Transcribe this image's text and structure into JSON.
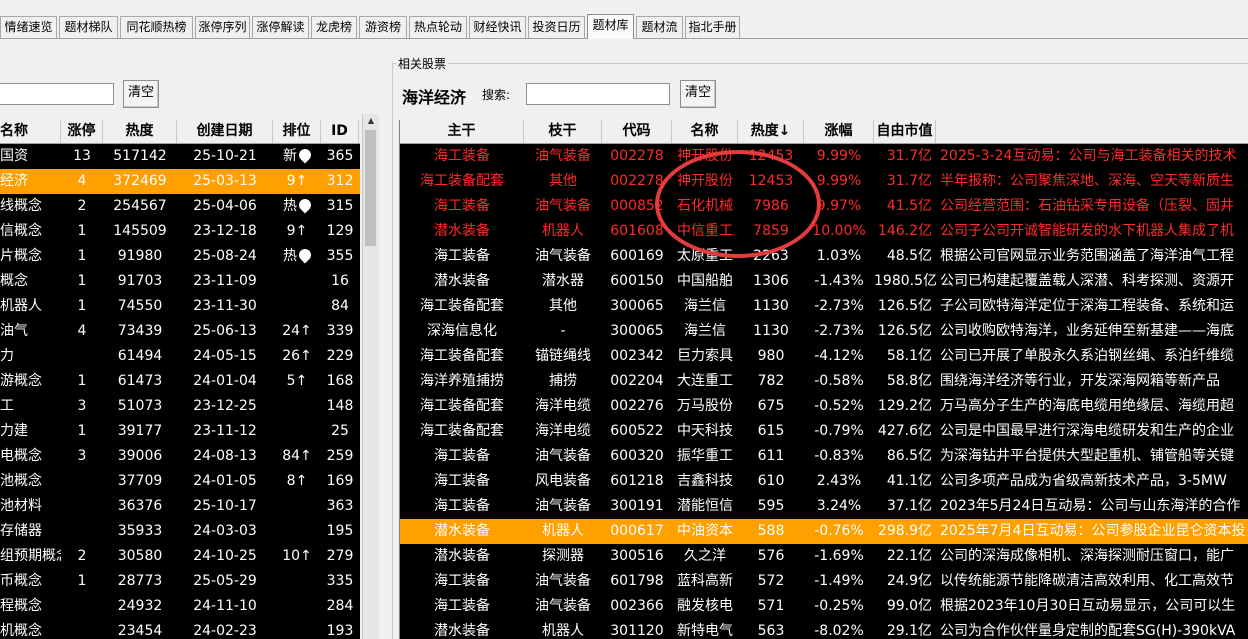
{
  "tabs": [
    "情绪速览",
    "题材梯队",
    "同花顺热榜",
    "涨停序列",
    "涨停解读",
    "龙虎榜",
    "游资榜",
    "热点轮动",
    "财经快讯",
    "投资日历",
    "题材库",
    "题材流",
    "指北手册"
  ],
  "active_tab": 10,
  "left": {
    "search_value": "",
    "clear_label": "清空",
    "headers": [
      "名称",
      "涨停",
      "热度",
      "创建日期",
      "排位",
      "ID"
    ],
    "rows": [
      [
        "国资",
        "13",
        "517142",
        "25-10-21",
        "新",
        "365"
      ],
      [
        "经济",
        "4",
        "372469",
        "25-03-13",
        "9↑",
        "312"
      ],
      [
        "线概念",
        "2",
        "254567",
        "25-04-06",
        "热",
        "315"
      ],
      [
        "信概念",
        "1",
        "145509",
        "23-12-18",
        "9↑",
        "129"
      ],
      [
        "片概念",
        "1",
        "91980",
        "25-08-24",
        "热",
        "355"
      ],
      [
        "概念",
        "1",
        "91703",
        "23-11-09",
        "",
        "16"
      ],
      [
        "机器人",
        "1",
        "74550",
        "23-11-30",
        "",
        "84"
      ],
      [
        "油气",
        "4",
        "73439",
        "25-06-13",
        "24↑",
        "339"
      ],
      [
        "力",
        "",
        "61494",
        "24-05-15",
        "26↑",
        "229"
      ],
      [
        "游概念",
        "1",
        "61473",
        "24-01-04",
        "5↑",
        "168"
      ],
      [
        "工",
        "3",
        "51073",
        "23-12-25",
        "",
        "148"
      ],
      [
        "力建",
        "1",
        "39177",
        "23-11-12",
        "",
        "25"
      ],
      [
        "电概念",
        "3",
        "39006",
        "24-08-13",
        "84↑",
        "259"
      ],
      [
        "池概念",
        "",
        "37709",
        "24-01-05",
        "8↑",
        "169"
      ],
      [
        "池材料",
        "",
        "36376",
        "25-10-17",
        "",
        "363"
      ],
      [
        "存储器",
        "",
        "35933",
        "24-03-03",
        "",
        "195"
      ],
      [
        "组预期概念",
        "2",
        "30580",
        "24-10-25",
        "10↑",
        "279"
      ],
      [
        "币概念",
        "1",
        "28773",
        "25-05-29",
        "",
        "335"
      ],
      [
        "程概念",
        "",
        "24932",
        "24-11-10",
        "",
        "284"
      ],
      [
        "机概念",
        "",
        "23454",
        "24-02-23",
        "",
        "193"
      ]
    ],
    "drop_rows": [
      0,
      2,
      4
    ],
    "selected_row": 1
  },
  "right": {
    "group_label": "相关股票",
    "theme_title": "海洋经济",
    "search_label": "搜索:",
    "search_value": "",
    "clear_label": "清空",
    "headers": [
      "主干",
      "枝干",
      "代码",
      "名称",
      "热度↓",
      "涨幅",
      "自由市值",
      ""
    ],
    "rows": [
      [
        "海工装备",
        "油气装备",
        "002278",
        "神开股份",
        "12453",
        "9.99%",
        "31.7亿",
        "2025-3-24互动易：公司与海工装备相关的技术"
      ],
      [
        "海工装备配套",
        "其他",
        "002278",
        "神开股份",
        "12453",
        "9.99%",
        "31.7亿",
        "半年报称：公司聚焦深地、深海、空天等新质生"
      ],
      [
        "海工装备",
        "油气装备",
        "000852",
        "石化机械",
        "7986",
        "9.97%",
        "41.5亿",
        "公司经营范围：石油钻采专用设备（压裂、固井"
      ],
      [
        "潜水装备",
        "机器人",
        "601608",
        "中信重工",
        "7859",
        "10.00%",
        "146.2亿",
        "公司子公司开诚智能研发的水下机器人集成了机"
      ],
      [
        "海工装备",
        "油气装备",
        "600169",
        "太原重工",
        "2263",
        "1.03%",
        "48.5亿",
        "根据公司官网显示业务范围涵盖了海洋油气工程"
      ],
      [
        "潜水装备",
        "潜水器",
        "600150",
        "中国船舶",
        "1306",
        "-1.43%",
        "1980.5亿",
        "公司已构建起覆盖载人深潜、科考探测、资源开"
      ],
      [
        "海工装备配套",
        "其他",
        "300065",
        "海兰信",
        "1130",
        "-2.73%",
        "126.5亿",
        "子公司欧特海洋定位于深海工程装备、系统和运"
      ],
      [
        "深海信息化",
        "-",
        "300065",
        "海兰信",
        "1130",
        "-2.73%",
        "126.5亿",
        "公司收购欧特海洋，业务延伸至新基建——海底"
      ],
      [
        "海工装备配套",
        "锚链绳线",
        "002342",
        "巨力索具",
        "980",
        "-4.12%",
        "58.1亿",
        "公司已开展了单股永久系泊钢丝绳、系泊纤维缆"
      ],
      [
        "海洋养殖捕捞",
        "捕捞",
        "002204",
        "大连重工",
        "782",
        "-0.58%",
        "58.8亿",
        "围绕海洋经济等行业，开发深海网箱等新产品"
      ],
      [
        "海工装备配套",
        "海洋电缆",
        "002276",
        "万马股份",
        "675",
        "-0.52%",
        "129.2亿",
        "万马高分子生产的海底电缆用绝缘层、海缆用超"
      ],
      [
        "海工装备配套",
        "海洋电缆",
        "600522",
        "中天科技",
        "615",
        "-0.79%",
        "427.6亿",
        "公司是中国最早进行深海电缆研发和生产的企业"
      ],
      [
        "海工装备",
        "油气装备",
        "600320",
        "振华重工",
        "611",
        "-0.83%",
        "86.5亿",
        "为深海钻井平台提供大型起重机、铺管船等关键"
      ],
      [
        "海工装备",
        "风电装备",
        "601218",
        "吉鑫科技",
        "610",
        "2.43%",
        "41.1亿",
        "公司多项产品成为省级高新技术产品，3-5MW"
      ],
      [
        "海工装备",
        "油气装备",
        "300191",
        "潜能恒信",
        "595",
        "3.24%",
        "37.1亿",
        "2023年5月24日互动易：公司与山东海洋的合作"
      ],
      [
        "潜水装备",
        "机器人",
        "000617",
        "中油资本",
        "588",
        "-0.76%",
        "298.9亿",
        "2025年7月4日互动易：公司参股企业昆仑资本投"
      ],
      [
        "潜水装备",
        "探测器",
        "300516",
        "久之洋",
        "576",
        "-1.69%",
        "22.1亿",
        "公司的深海成像相机、深海探测耐压窗口，能广"
      ],
      [
        "海工装备",
        "油气装备",
        "601798",
        "蓝科高新",
        "572",
        "-1.49%",
        "24.9亿",
        "以传统能源节能降碳清洁高效利用、化工高效节"
      ],
      [
        "海工装备",
        "油气装备",
        "002366",
        "融发核电",
        "571",
        "-0.25%",
        "99.0亿",
        "根据2023年10月30日互动易显示，公司可以生"
      ],
      [
        "潜水装备",
        "机器人",
        "301120",
        "新特电气",
        "563",
        "-8.02%",
        "29.1亿",
        "公司为合作伙伴量身定制的配套SG(H)-390kVA"
      ]
    ],
    "red_rows": [
      0,
      1,
      2,
      3
    ],
    "selected_row": 15
  },
  "colors": {
    "selected_row_bg": "#ff9f00",
    "limit_up_red": "#ff2a2a",
    "grid_bg": "#000000",
    "annotation_circle": "#e43c3c"
  }
}
